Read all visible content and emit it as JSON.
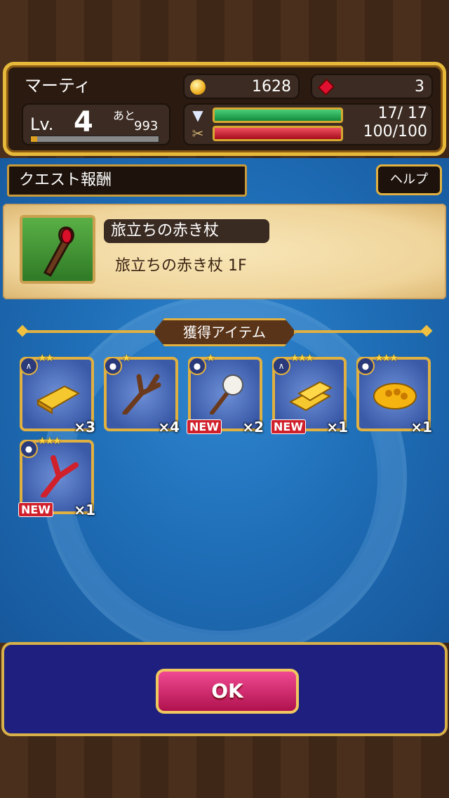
{
  "player": {
    "name": "マーティ",
    "level_label": "Lv.",
    "level": "4",
    "exp_label": "あと",
    "exp_remaining": "993",
    "exp_progress": 0.05
  },
  "currency": {
    "coins": "1628",
    "gems": "3"
  },
  "stats": {
    "stamina_text": "17/ 17",
    "stamina_fraction": 1.0,
    "hp_text": "100/100",
    "hp_fraction": 1.0
  },
  "header": {
    "title": "クエスト報酬",
    "help_label": "ヘルプ"
  },
  "quest": {
    "title": "旅立ちの赤き杖",
    "stage": "旅立ちの赤き杖 1F",
    "icon": "red-staff-icon"
  },
  "items_section": {
    "title": "獲得アイテム"
  },
  "items": [
    {
      "icon": "gold-bar-icon",
      "stars": "★★",
      "count": "×3",
      "new": ""
    },
    {
      "icon": "branch-icon",
      "stars": "★",
      "count": "×4",
      "new": ""
    },
    {
      "icon": "cotton-icon",
      "stars": "★",
      "count": "×2",
      "new": "NEW"
    },
    {
      "icon": "gold-bars-icon",
      "stars": "★★★",
      "count": "×1",
      "new": "NEW"
    },
    {
      "icon": "honeycomb-icon",
      "stars": "★★★",
      "count": "×1",
      "new": ""
    },
    {
      "icon": "red-branch-icon",
      "stars": "★★★",
      "count": "×1",
      "new": "NEW"
    }
  ],
  "footer": {
    "ok_label": "OK"
  },
  "colors": {
    "gold_frame": "#e0b040",
    "ok_button": "#d0206c",
    "footer_bg": "#1e1f7e",
    "blue_bg": "#1f6fb8"
  }
}
